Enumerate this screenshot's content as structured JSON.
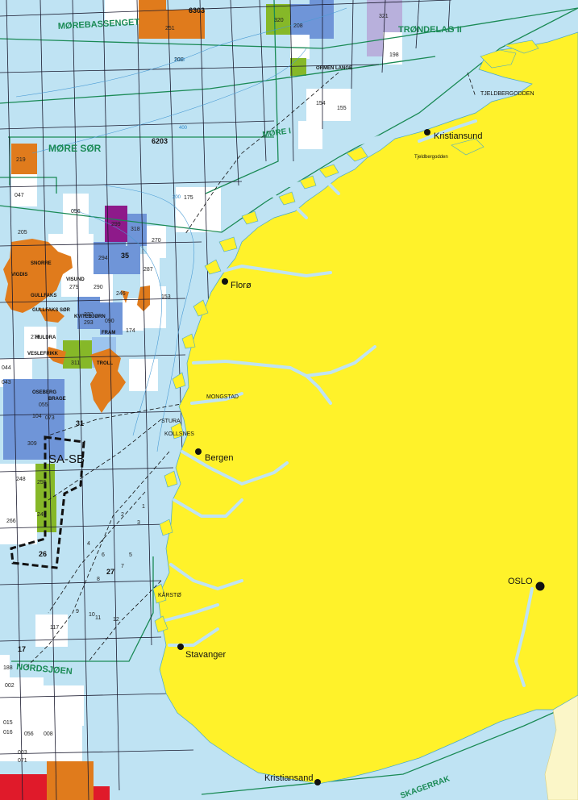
{
  "colors": {
    "sea": "#bfe3f3",
    "land": "#fff22a",
    "sweden": "#fbf6c8",
    "grid": "#1a1a2e",
    "area_boundary": "#1a8a55",
    "orange": "#e07b1c",
    "blue": "#6f95d8",
    "light_blue": "#9cc4ee",
    "purple": "#8e1a8a",
    "lavender": "#b8b0dc",
    "green": "#86b828",
    "red": "#e01a2a",
    "white": "#ffffff"
  },
  "quadrants": [
    "6303",
    "6203",
    "35",
    "31",
    "27",
    "26",
    "17"
  ],
  "area_labels": [
    "MØREBASSENGET",
    "TRØNDELAG II",
    "MØRE SØR",
    "MØRE I",
    "NORDSJØEN",
    "SKAGERRAK"
  ],
  "cities": [
    "Kristiansund",
    "Florø",
    "Bergen",
    "Stavanger",
    "Kristiansand",
    "OSLO"
  ],
  "places": [
    "TJELDBERGODDEN",
    "Tjeldbergodden",
    "MONGSTAD",
    "STURA",
    "KOLLSNES",
    "KÅRSTØ"
  ],
  "fields": [
    "ORMEN LANGE",
    "SNORRE",
    "VIGDIS",
    "VISUND",
    "GULLFAKS",
    "GULLFAKS SØR",
    "KVITEBJØRN",
    "HULDRA",
    "VESLEFRIKK",
    "TROLL",
    "FRAM",
    "OSEBERG",
    "BRAGE"
  ],
  "blocks": [
    "251",
    "320",
    "208",
    "321",
    "198",
    "200",
    "154",
    "155",
    "219",
    "047",
    "056",
    "175",
    "205",
    "299",
    "318",
    "270",
    "294",
    "287",
    "153",
    "279",
    "290",
    "246",
    "232",
    "293",
    "090",
    "174",
    "278",
    "311",
    "044",
    "043",
    "055",
    "073",
    "104",
    "309",
    "255",
    "248",
    "245",
    "266",
    "117",
    "188",
    "002",
    "015",
    "016",
    "056",
    "008",
    "003",
    "071"
  ],
  "depth_labels": [
    "1000",
    "400",
    "200"
  ],
  "ruler_labels": [
    "1",
    "2",
    "3",
    "4",
    "5",
    "6",
    "7",
    "8",
    "9",
    "10",
    "11",
    "12"
  ],
  "special_label": "SA-SB"
}
